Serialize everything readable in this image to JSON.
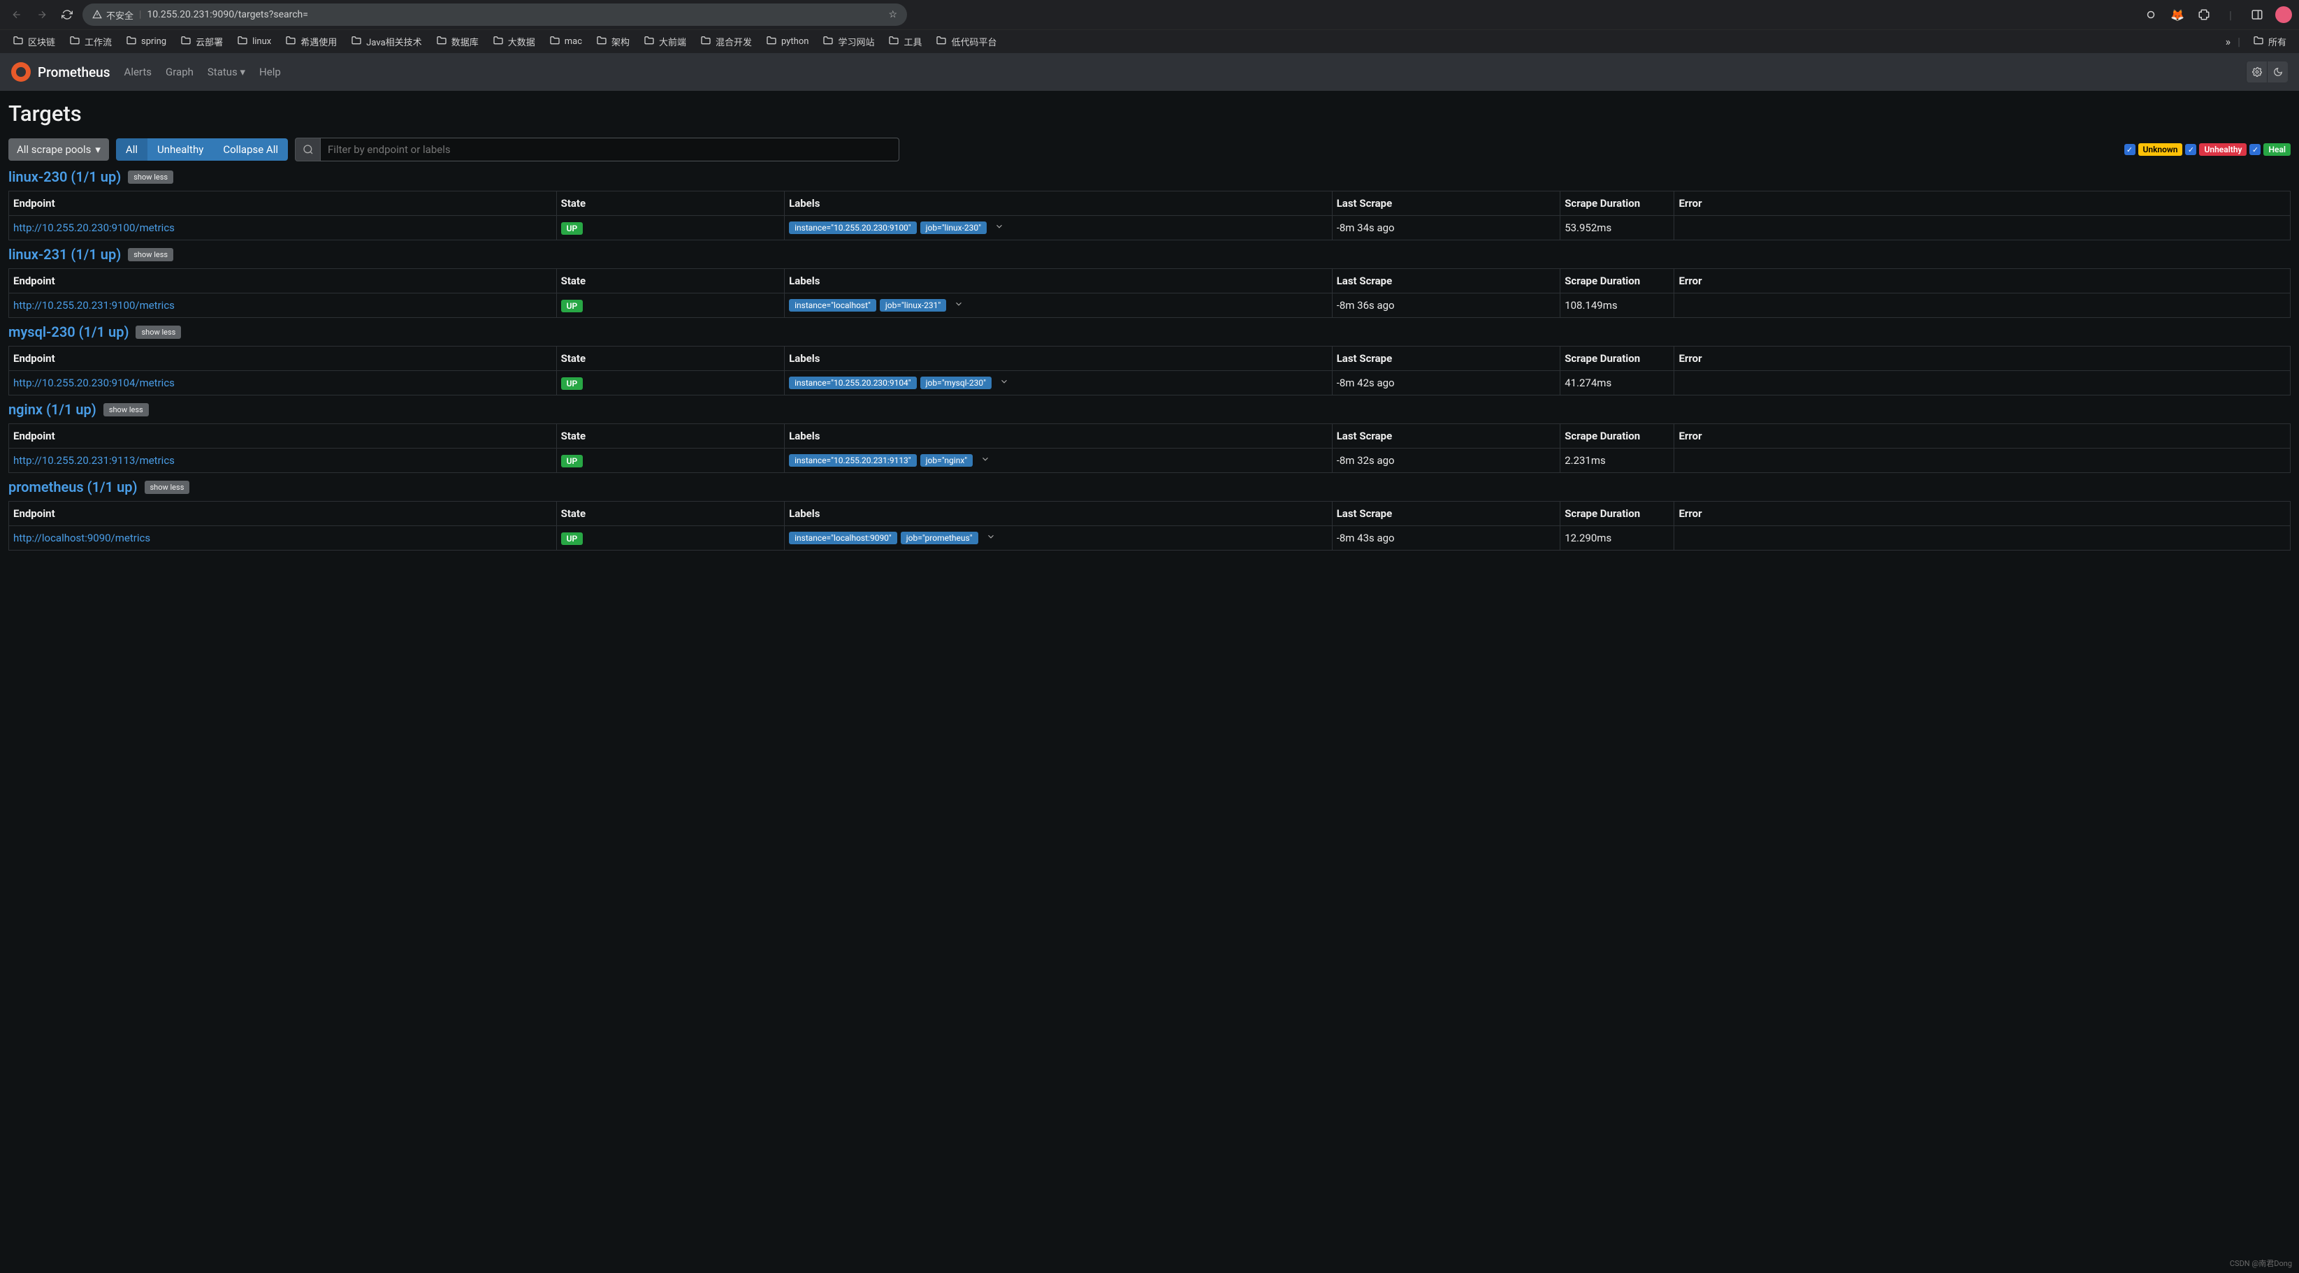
{
  "browser": {
    "url_warning": "不安全",
    "url": "10.255.20.231:9090/targets?search="
  },
  "bookmarks": [
    "区块链",
    "工作流",
    "spring",
    "云部署",
    "linux",
    "希遇使用",
    "Java相关技术",
    "数据库",
    "大数据",
    "mac",
    "架构",
    "大前端",
    "混合开发",
    "python",
    "学习网站",
    "工具",
    "低代码平台"
  ],
  "bookmarks_all": "所有",
  "nav": {
    "brand": "Prometheus",
    "links": [
      "Alerts",
      "Graph",
      "Status",
      "Help"
    ]
  },
  "page": {
    "title": "Targets"
  },
  "controls": {
    "scrape_pools": "All scrape pools",
    "all": "All",
    "unhealthy": "Unhealthy",
    "collapse": "Collapse All",
    "search_placeholder": "Filter by endpoint or labels"
  },
  "legend": {
    "unknown": "Unknown",
    "unhealthy": "Unhealthy",
    "healthy": "Heal"
  },
  "headers": {
    "endpoint": "Endpoint",
    "state": "State",
    "labels": "Labels",
    "last": "Last Scrape",
    "duration": "Scrape Duration",
    "error": "Error"
  },
  "show_less": "show less",
  "pools": [
    {
      "title": "linux-230 (1/1 up)",
      "rows": [
        {
          "endpoint": "http://10.255.20.230:9100/metrics",
          "state": "UP",
          "labels": [
            "instance=\"10.255.20.230:9100\"",
            "job=\"linux-230\""
          ],
          "last": "-8m 34s ago",
          "duration": "53.952ms",
          "error": ""
        }
      ]
    },
    {
      "title": "linux-231 (1/1 up)",
      "rows": [
        {
          "endpoint": "http://10.255.20.231:9100/metrics",
          "state": "UP",
          "labels": [
            "instance=\"localhost\"",
            "job=\"linux-231\""
          ],
          "last": "-8m 36s ago",
          "duration": "108.149ms",
          "error": ""
        }
      ]
    },
    {
      "title": "mysql-230 (1/1 up)",
      "rows": [
        {
          "endpoint": "http://10.255.20.230:9104/metrics",
          "state": "UP",
          "labels": [
            "instance=\"10.255.20.230:9104\"",
            "job=\"mysql-230\""
          ],
          "last": "-8m 42s ago",
          "duration": "41.274ms",
          "error": ""
        }
      ]
    },
    {
      "title": "nginx (1/1 up)",
      "rows": [
        {
          "endpoint": "http://10.255.20.231:9113/metrics",
          "state": "UP",
          "labels": [
            "instance=\"10.255.20.231:9113\"",
            "job=\"nginx\""
          ],
          "last": "-8m 32s ago",
          "duration": "2.231ms",
          "error": ""
        }
      ]
    },
    {
      "title": "prometheus (1/1 up)",
      "rows": [
        {
          "endpoint": "http://localhost:9090/metrics",
          "state": "UP",
          "labels": [
            "instance=\"localhost:9090\"",
            "job=\"prometheus\""
          ],
          "last": "-8m 43s ago",
          "duration": "12.290ms",
          "error": ""
        }
      ]
    }
  ],
  "watermark": "CSDN @南君Dong"
}
